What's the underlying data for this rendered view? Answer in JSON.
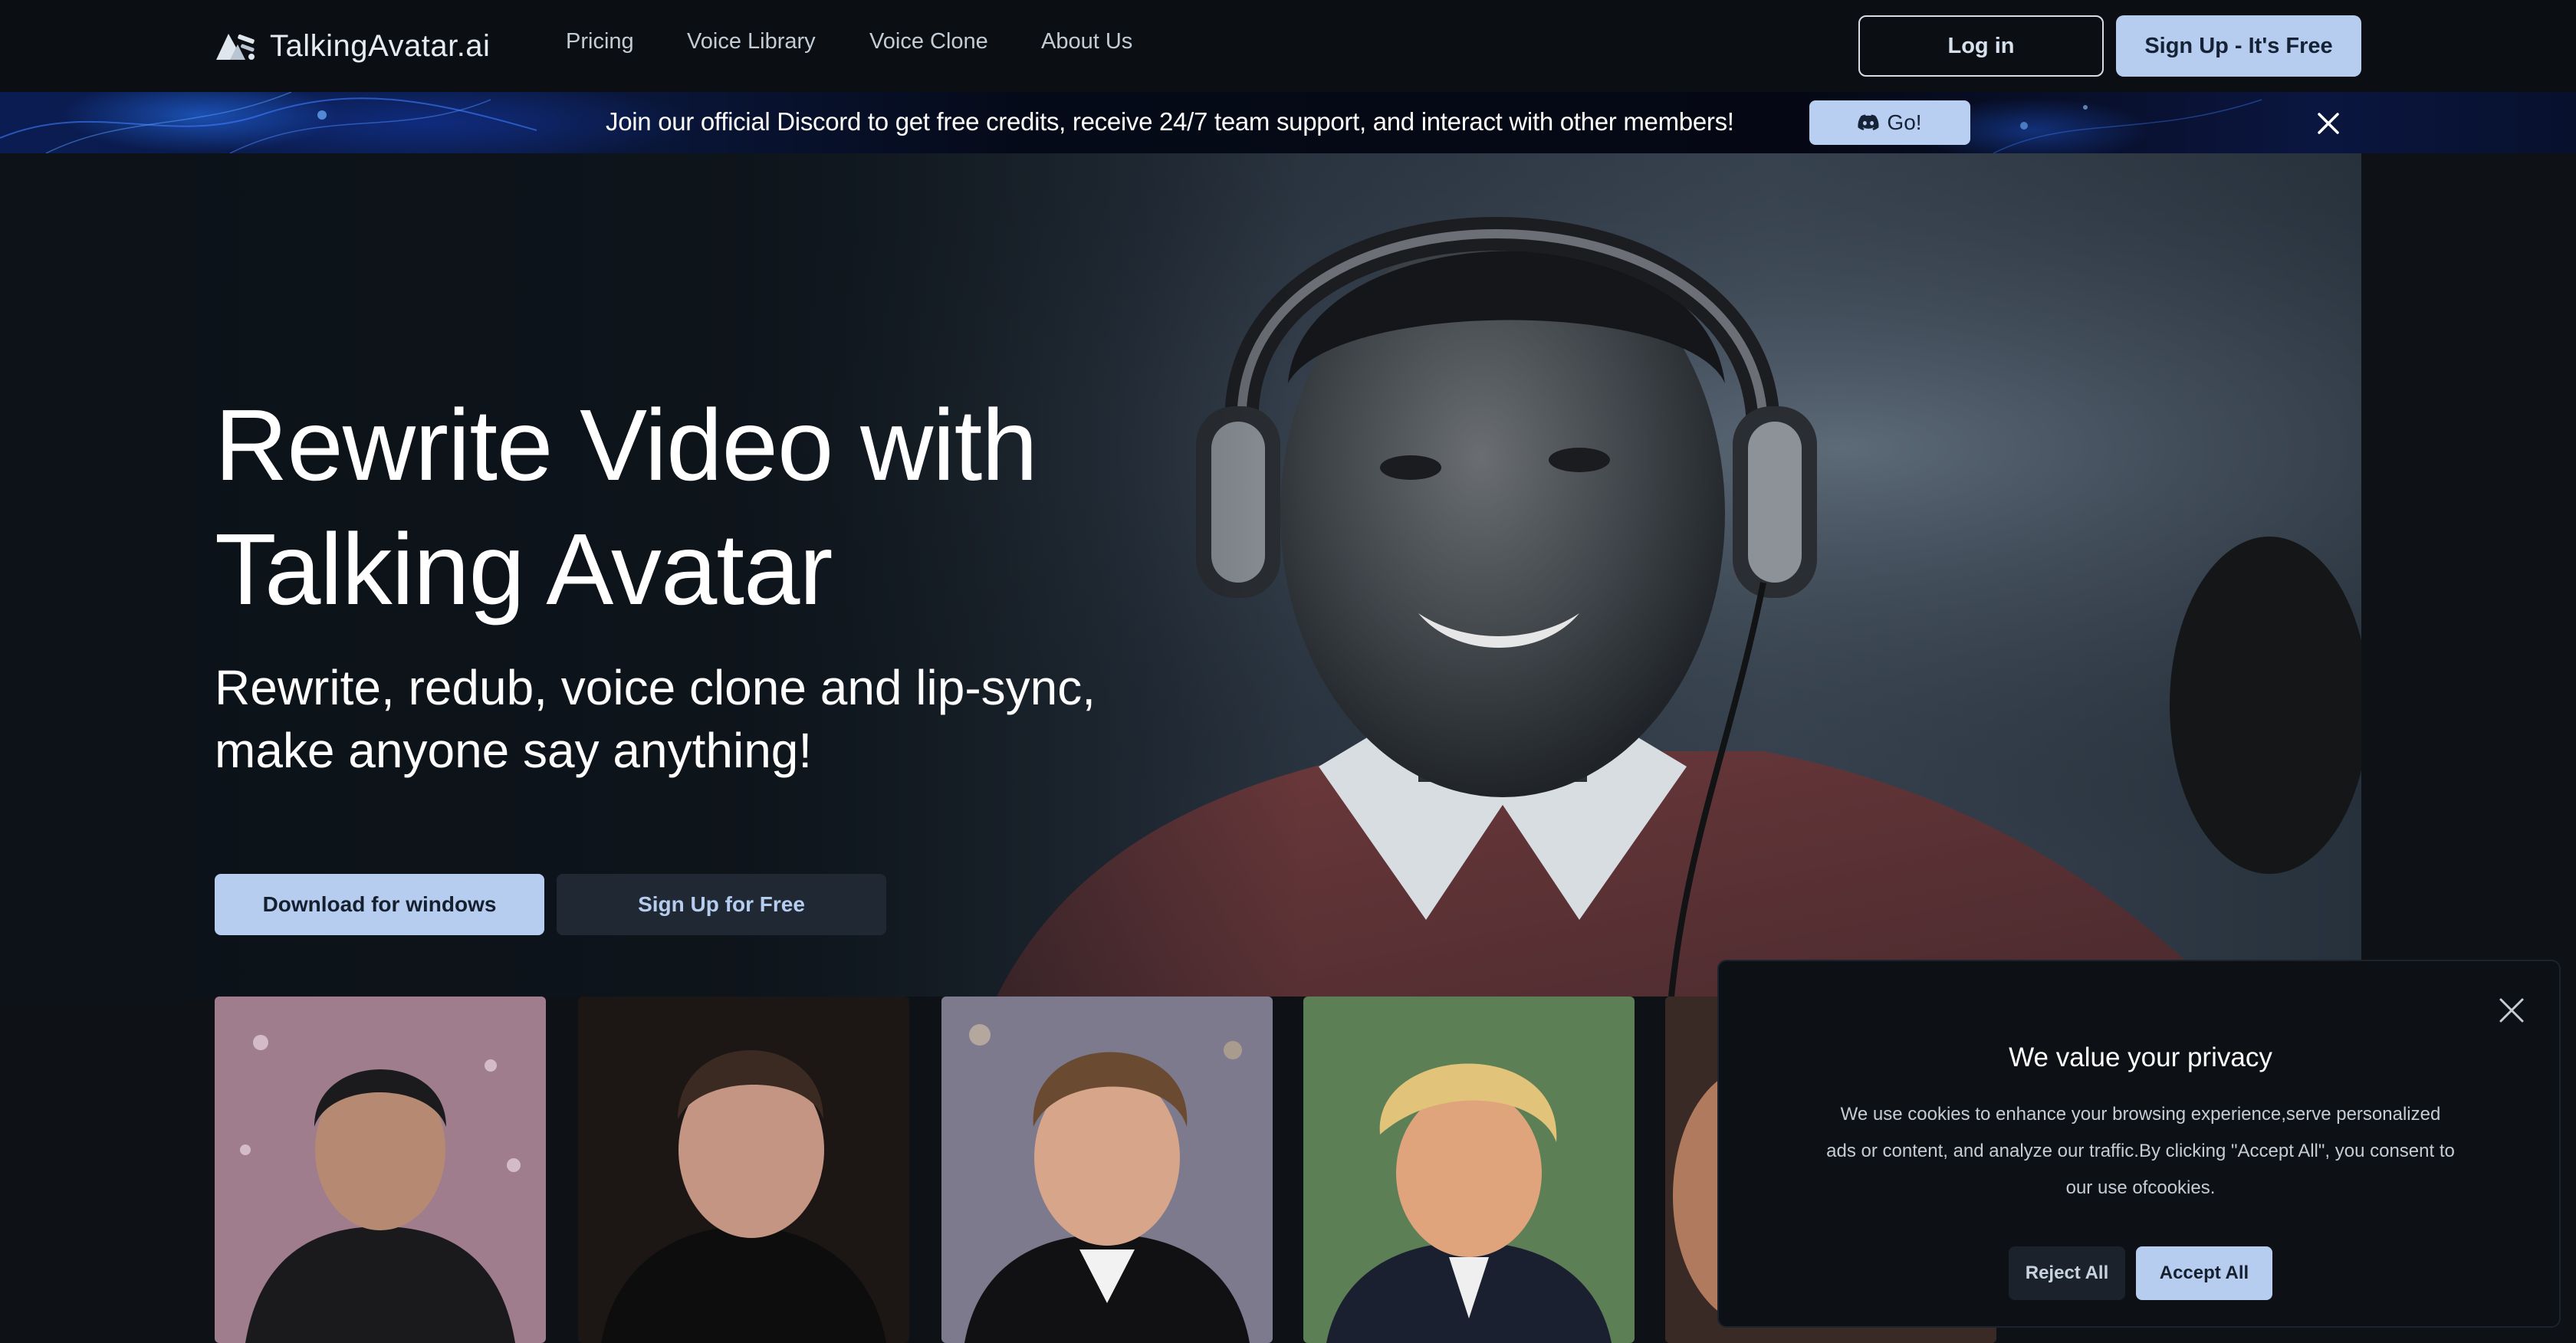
{
  "navbar": {
    "logo_text": "TalkingAvatar.ai",
    "links": [
      "Pricing",
      "Voice Library",
      "Voice Clone",
      "About Us"
    ],
    "login_label": "Log in",
    "signup_label": "Sign Up - It's Free"
  },
  "banner": {
    "text": "Join our official Discord to get free credits, receive 24/7 team support, and interact with other members!",
    "button_label": "Go!",
    "button_icon": "discord-icon",
    "close_icon": "close-icon"
  },
  "hero": {
    "title_lines": [
      "Rewrite Video with",
      "Talking Avatar"
    ],
    "subtitle_lines": [
      "Rewrite, redub, voice clone and lip-sync,",
      "make anyone say anything!"
    ],
    "download_label": "Download for windows",
    "signup_label": "Sign Up for Free"
  },
  "thumbnails": [
    {
      "name": "avatar-thumb-1"
    },
    {
      "name": "avatar-thumb-2"
    },
    {
      "name": "avatar-thumb-3"
    },
    {
      "name": "avatar-thumb-4"
    },
    {
      "name": "avatar-thumb-5"
    }
  ],
  "cookie": {
    "title": "We value your privacy",
    "text": "We use cookies to enhance your browsing experience,serve personalized ads or content, and analyze our traffic.By clicking \"Accept All\", you consent to our use ofcookies.",
    "reject_label": "Reject All",
    "accept_label": "Accept All",
    "close_icon": "close-icon"
  },
  "colors": {
    "accent": "#b6cdf0",
    "background": "#0e1217",
    "navbar": "#0b0f13"
  }
}
